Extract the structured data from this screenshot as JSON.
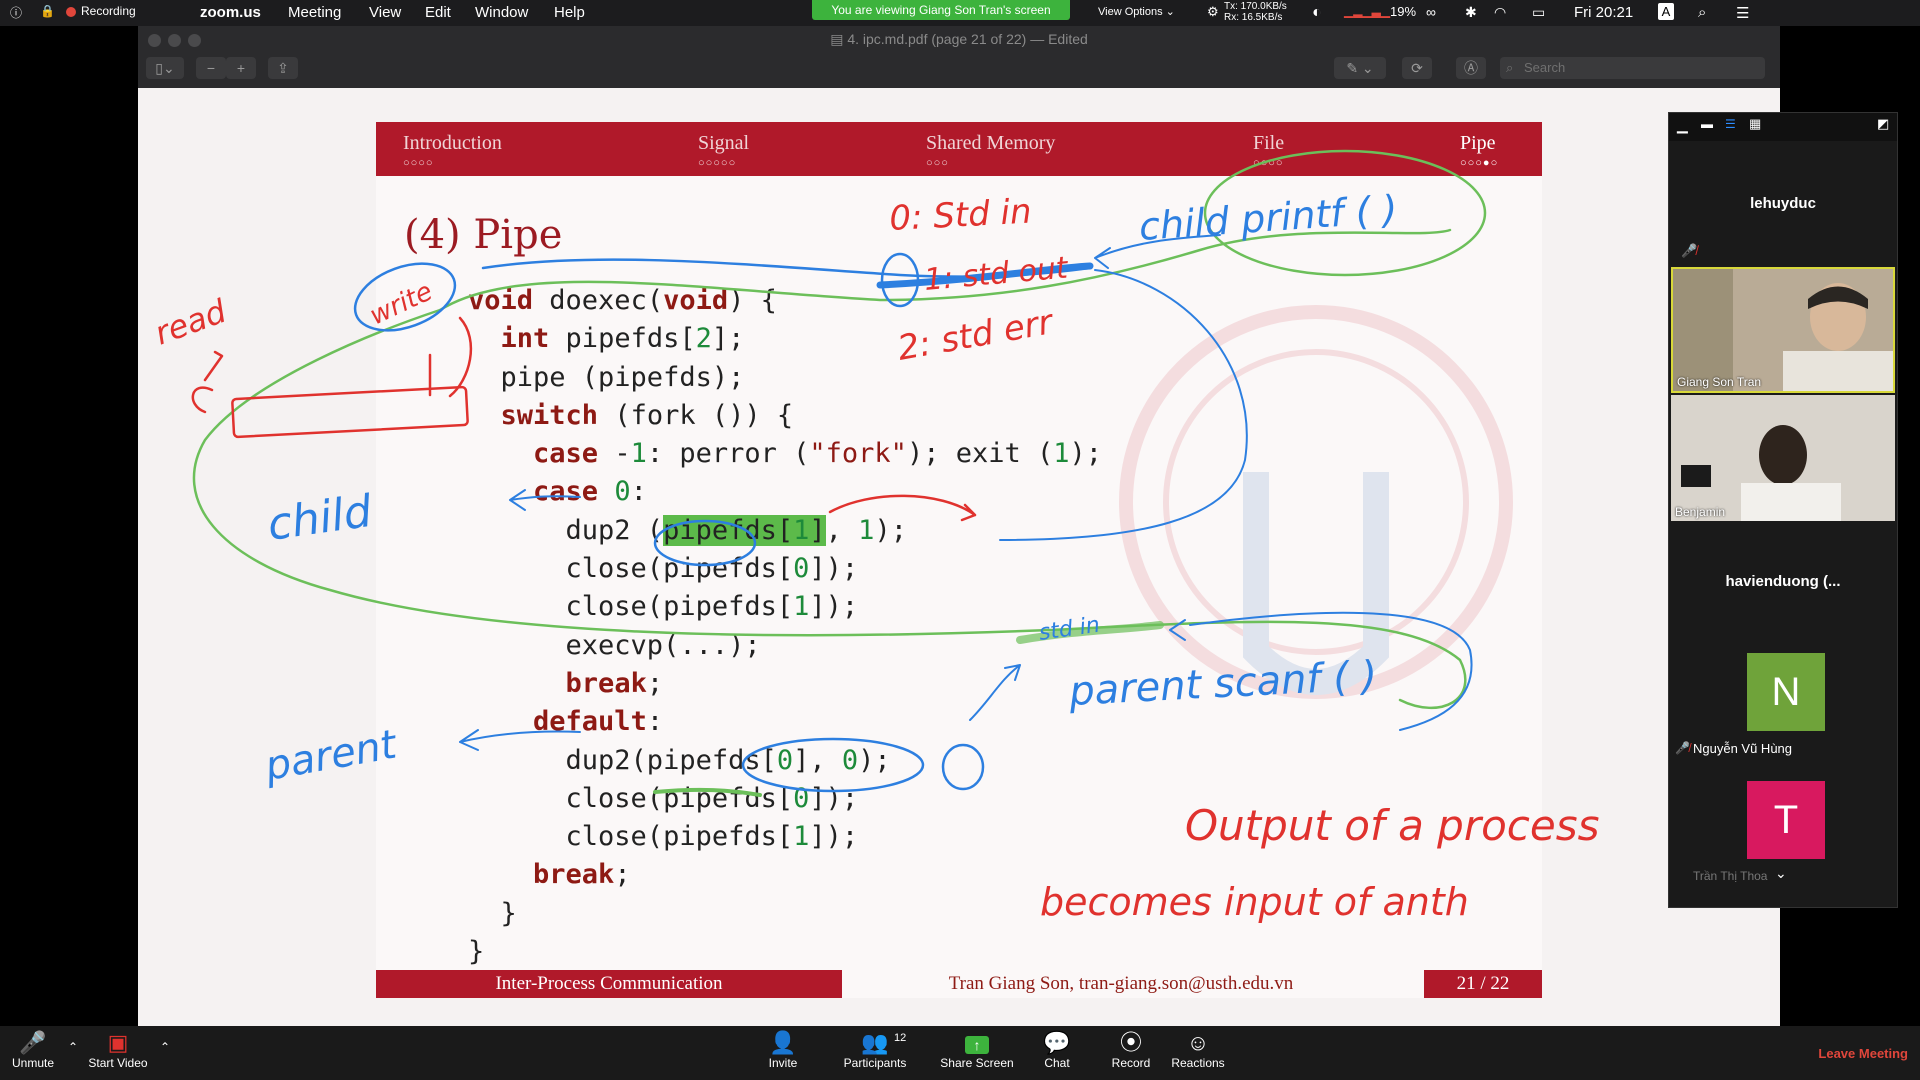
{
  "menubar": {
    "recording": "Recording",
    "app": "zoom.us",
    "menus": [
      "Meeting",
      "View",
      "Edit",
      "Window",
      "Help"
    ],
    "share_banner": "You are viewing Giang Son Tran's screen",
    "view_options": "View Options",
    "net_tx": "Tx: 170.0KB/s",
    "net_rx": "Rx: 16.5KB/s",
    "battery": "19%",
    "clock": "Fri 20:21",
    "input_source": "A"
  },
  "preview": {
    "doc_title": "4. ipc.md.pdf (page 21 of 22)",
    "edited": "— Edited",
    "search_placeholder": "Search"
  },
  "slide": {
    "nav": [
      {
        "label": "Introduction",
        "dots": "○○○○"
      },
      {
        "label": "Signal",
        "dots": "○○○○○"
      },
      {
        "label": "Shared Memory",
        "dots": "○○○"
      },
      {
        "label": "File",
        "dots": "○○○○"
      },
      {
        "label": "Pipe",
        "dots": "○○○●○"
      }
    ],
    "title": "(4) Pipe",
    "footer_left": "Inter-Process Communication",
    "footer_mid": "Tran Giang Son, tran-giang.son@usth.edu.vn",
    "footer_right": "21 / 22"
  },
  "annotations": {
    "read": "read",
    "write": "write",
    "child": "child",
    "parent": "parent",
    "std0": "0: Std in",
    "std1": "1: std out",
    "std2": "2: std err",
    "child_printf": "child printf ( )",
    "parent_scanf": "parent scanf ( )",
    "stdin_mark": "std in",
    "note1": "Output of a process",
    "note2": "becomes input of anth"
  },
  "gallery": {
    "p1": "lehuyduc",
    "p2": "Giang Son Tran",
    "p3": "Benjamin",
    "p4": "havienduong  (...",
    "p5_initial": "N",
    "p5": "Nguyễn Vũ Hùng",
    "p6_initial": "T",
    "p6": "Trần Thị Thoa",
    "colors": {
      "n_tile": "#6fa33a",
      "t_tile": "#d8195f"
    }
  },
  "toolbar": {
    "unmute": "Unmute",
    "start_video": "Start Video",
    "invite": "Invite",
    "participants": "Participants",
    "participants_count": "12",
    "share": "Share Screen",
    "chat": "Chat",
    "record": "Record",
    "reactions": "Reactions",
    "leave": "Leave Meeting"
  }
}
